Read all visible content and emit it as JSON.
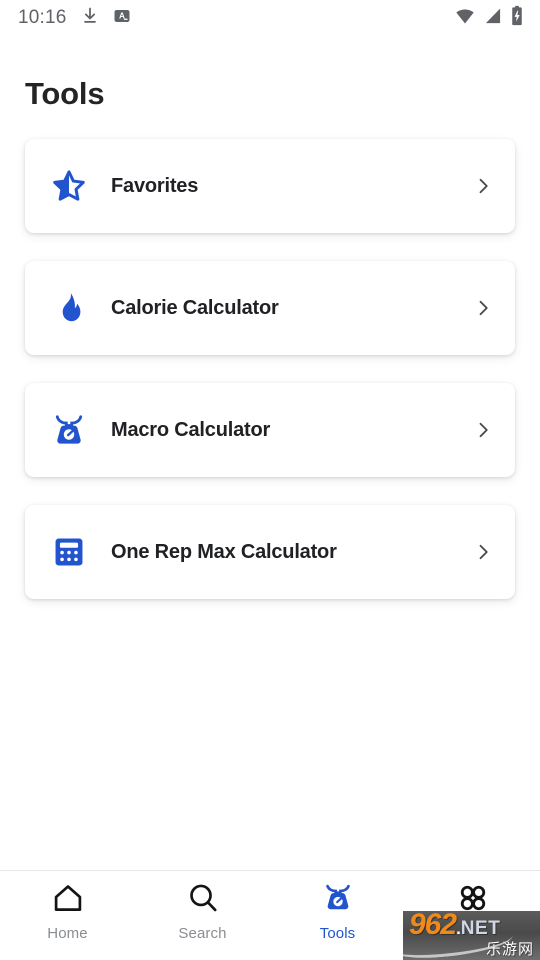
{
  "status_bar": {
    "time": "10:16",
    "left_icons": [
      "download-icon",
      "subtitle-a-icon"
    ],
    "right_icons": [
      "wifi-icon",
      "cell-signal-icon",
      "battery-charging-icon"
    ],
    "text_color": "#5f6368"
  },
  "header": {
    "title": "Tools"
  },
  "theme": {
    "accent": "#2154cd",
    "text": "#202124",
    "muted": "#8a8d91",
    "card_bg": "#ffffff",
    "page_bg": "#ffffff"
  },
  "tools": [
    {
      "label": "Favorites",
      "icon": "star-half-icon",
      "chevron": "chevron-right-icon"
    },
    {
      "label": "Calorie Calculator",
      "icon": "flame-icon",
      "chevron": "chevron-right-icon"
    },
    {
      "label": "Macro Calculator",
      "icon": "food-scale-icon",
      "chevron": "chevron-right-icon"
    },
    {
      "label": "One Rep Max Calculator",
      "icon": "calculator-icon",
      "chevron": "chevron-right-icon"
    }
  ],
  "bottom_nav": {
    "items": [
      {
        "label": "Home",
        "icon": "home-icon",
        "active": false
      },
      {
        "label": "Search",
        "icon": "search-icon",
        "active": false
      },
      {
        "label": "Tools",
        "icon": "toolbox-icon",
        "active": true
      },
      {
        "label": "",
        "icon": "grid-dots-icon",
        "active": false
      }
    ]
  },
  "watermark": {
    "brand": "962",
    "dot": ".",
    "tld": "NET",
    "chinese": "乐游网"
  }
}
